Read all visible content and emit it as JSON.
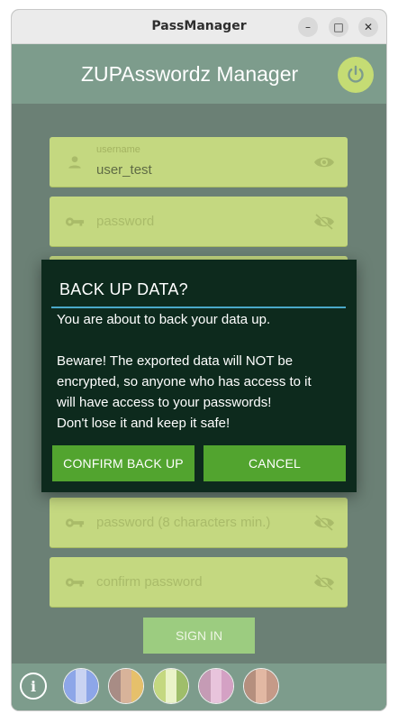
{
  "window": {
    "title": "PassManager",
    "minimize": "–",
    "maximize": "□",
    "close": "✕"
  },
  "header": {
    "title": "ZUPAsswordz Manager",
    "power_icon": "power-icon"
  },
  "form": {
    "username": {
      "label": "username",
      "value": "user_test",
      "icon": "person-icon"
    },
    "password": {
      "placeholder": "password",
      "icon": "key-icon"
    },
    "new_password": {
      "placeholder": "password (8 characters min.)",
      "icon": "key-icon"
    },
    "confirm_password": {
      "placeholder": "confirm password",
      "icon": "key-icon"
    },
    "sign_in": "SIGN IN"
  },
  "dialog": {
    "title": "BACK UP DATA?",
    "lines": [
      "You are about to back your data up.",
      "",
      "Beware! The exported data will NOT be",
      "encrypted, so anyone who has access to it",
      "will have access to your passwords!",
      "Don't lose it and keep it safe!"
    ],
    "confirm": "CONFIRM BACK UP",
    "cancel": "CANCEL"
  },
  "bottom": {
    "info": "i",
    "themes": [
      [
        "#8da6e8",
        "#c9d3f2",
        "#8da6e8"
      ],
      [
        "#a88c85",
        "#d8b39a",
        "#e6c06b"
      ],
      [
        "#c4d880",
        "#eaf3c8",
        "#9fbe6a"
      ],
      [
        "#c59bb5",
        "#e8c4dc",
        "#d4a1c4"
      ],
      [
        "#b58f7e",
        "#e2b8a3",
        "#c59a88"
      ]
    ]
  },
  "colors": {
    "dialog_bg": "#0d2a1d",
    "button_green": "#52a42f",
    "field_bg": "#c4d880",
    "accent_underline": "#4aa8c8"
  }
}
